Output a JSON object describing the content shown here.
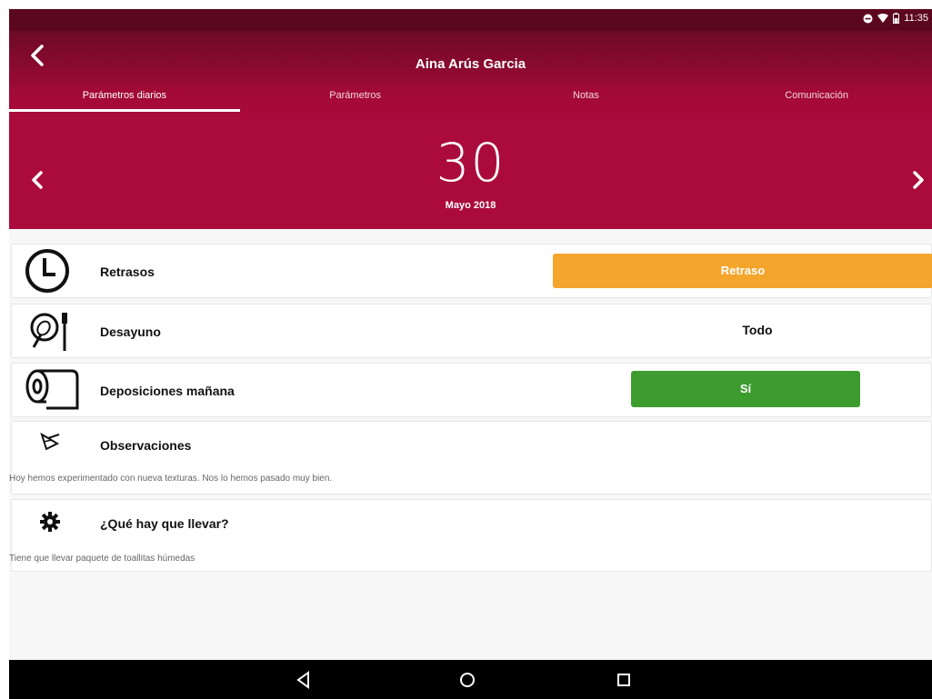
{
  "status_bar": {
    "time": "11:35"
  },
  "header": {
    "title": "Aina Arús Garcia"
  },
  "tabs": [
    {
      "label": "Parámetros diarios"
    },
    {
      "label": "Parámetros"
    },
    {
      "label": "Notas"
    },
    {
      "label": "Comunicación"
    }
  ],
  "date": {
    "day": "30",
    "month": "Mayo 2018"
  },
  "rows": {
    "retrasos": {
      "label": "Retrasos",
      "button": "Retraso"
    },
    "desayuno": {
      "label": "Desayuno",
      "value": "Todo"
    },
    "deposiciones": {
      "label": "Deposiciones mañana",
      "button": "Sí"
    },
    "observaciones": {
      "label": "Observaciones",
      "text": "Hoy hemos experimentado con nueva texturas. Nos lo hemos pasado muy bien."
    },
    "llevar": {
      "label": "¿Qué hay que llevar?",
      "text": "Tiene que llevar paquete de toallitas húmedas"
    }
  },
  "colors": {
    "primary": "#a80a38",
    "retraso": "#f4a52c",
    "si": "#3c9c2e"
  }
}
